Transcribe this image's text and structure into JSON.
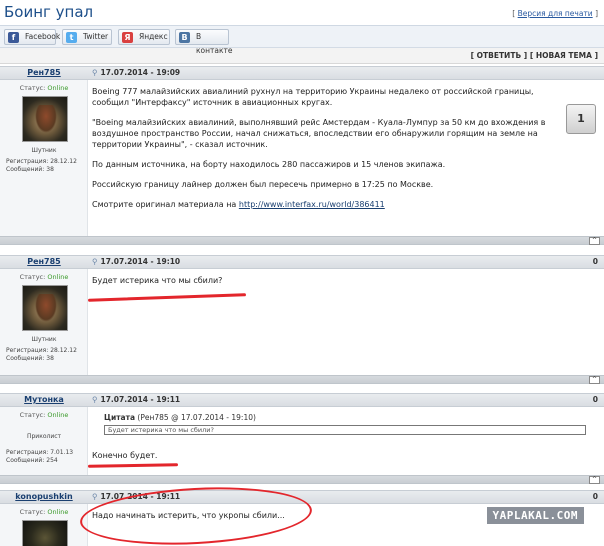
{
  "page": {
    "title": "Боинг упал",
    "print_link": "Версия для печати"
  },
  "share": [
    {
      "label": "Facebook",
      "icon": "facebook-icon",
      "glyph": "f",
      "color": "#3b5998"
    },
    {
      "label": "Twitter",
      "icon": "twitter-icon",
      "glyph": "t",
      "color": "#55acee"
    },
    {
      "label": "Яндекс",
      "icon": "yandex-icon",
      "glyph": "Я",
      "color": "#d94040"
    },
    {
      "label": "В контакте",
      "icon": "vkontakte-icon",
      "glyph": "В",
      "color": "#4c75a3"
    }
  ],
  "actions": {
    "reply": "ОТВЕТИТЬ",
    "new_topic": "НОВАЯ ТЕМА"
  },
  "posts": [
    {
      "author": "Рен785",
      "date": "17.07.2014 - 19:09",
      "status_label": "Статус:",
      "status_value": "Online",
      "rank": "Шутник",
      "reg_label": "Регистрация:",
      "reg_value": "28.12.12",
      "msgs_label": "Сообщений:",
      "msgs_value": "38",
      "rating": "1",
      "paragraphs": [
        "Boeing 777 малайзийских авиалиний рухнул на территорию Украины недалеко от российской границы, сообщил \"Интерфаксу\" источник в авиационных кругах.",
        "\"Boeing малайзийских авиалиний, выполнявший рейс Амстердам - Куала-Лумпур за 50 км до вхождения в воздушное пространство России, начал снижаться, впоследствии его обнаружили горящим на земле на территории Украины\", - сказал источник.",
        "По данным источника, на борту находилось 280 пассажиров и 15 членов экипажа.",
        "Российскую границу лайнер должен был пересечь примерно в 17:25 по Москве."
      ],
      "source_prefix": "Смотрите оригинал материала на ",
      "source_link": "http://www.interfax.ru/world/386411"
    },
    {
      "author": "Рен785",
      "date": "17.07.2014 - 19:10",
      "votes": "0",
      "status_label": "Статус:",
      "status_value": "Online",
      "rank": "Шутник",
      "reg_label": "Регистрация:",
      "reg_value": "28.12.12",
      "msgs_label": "Сообщений:",
      "msgs_value": "38",
      "text": "Будет истерика что мы сбили?"
    },
    {
      "author": "Мутонка",
      "date": "17.07.2014 - 19:11",
      "votes": "0",
      "status_label": "Статус:",
      "status_value": "Online",
      "rank": "Приколист",
      "reg_label": "Регистрация:",
      "reg_value": "7.01.13",
      "msgs_label": "Сообщений:",
      "msgs_value": "254",
      "quote_label": "Цитата",
      "quote_meta": "(Рен785 @ 17.07.2014 - 19:10)",
      "quote_text": "Будет истерика что мы сбили?",
      "text": "Конечно будет."
    },
    {
      "author": "konopushkin",
      "date": "17.07.2014 - 19:11",
      "votes": "0",
      "status_label": "Статус:",
      "status_value": "Online",
      "text": "Надо начинать истерить, что укропы сбили..."
    }
  ],
  "watermark": "YAPLAKAL.COM",
  "colors": {
    "annotation": "#e3262c",
    "link": "#1a3f70",
    "online": "#3a9a2a"
  }
}
